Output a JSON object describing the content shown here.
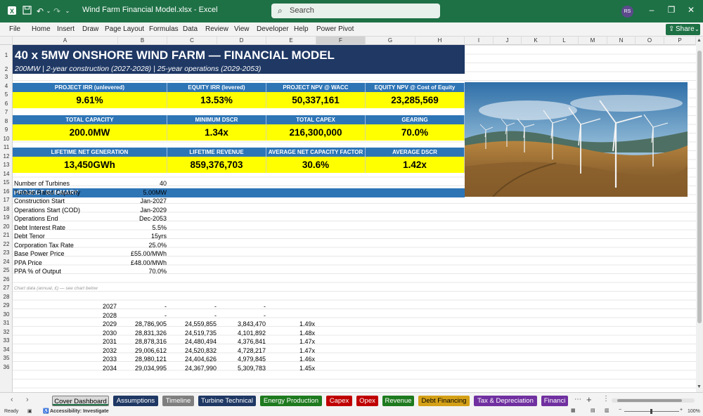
{
  "window": {
    "title": "Wind Farm Financial Model.xlsx  -  Excel",
    "search_placeholder": "Search",
    "user_initials": "RS"
  },
  "ribbon": {
    "tabs": [
      "File",
      "Home",
      "Insert",
      "Draw",
      "Page Layout",
      "Formulas",
      "Data",
      "Review",
      "View",
      "Developer",
      "Help",
      "Power Pivot"
    ],
    "share_label": "Share"
  },
  "columns": [
    "A",
    "B",
    "C",
    "D",
    "E",
    "F",
    "G",
    "H",
    "I",
    "J",
    "K",
    "L",
    "M",
    "N",
    "O",
    "P"
  ],
  "rows": [
    "1",
    "2",
    "3",
    "4",
    "5",
    "6",
    "7",
    "8",
    "9",
    "10",
    "11",
    "12",
    "13",
    "14",
    "15",
    "16",
    "17",
    "18",
    "19",
    "20",
    "21",
    "22",
    "23",
    "24",
    "25",
    "26",
    "27",
    "28",
    "29",
    "30",
    "31",
    "32",
    "33",
    "34",
    "35",
    "36"
  ],
  "sheet": {
    "title": "40 x 5MW ONSHORE WIND FARM — FINANCIAL MODEL",
    "subtitle": "200MW | 2-year construction (2027-2028) | 25-year operations (2029-2053)",
    "kpi_rows": [
      [
        {
          "label": "PROJECT IRR (unlevered)",
          "value": "9.61%"
        },
        {
          "label": "EQUITY IRR (levered)",
          "value": "13.53%"
        },
        {
          "label": "PROJECT NPV @ WACC",
          "value": "50,337,161"
        },
        {
          "label": "EQUITY NPV @ Cost of Equity",
          "value": "23,285,569"
        }
      ],
      [
        {
          "label": "TOTAL CAPACITY",
          "value": "200.0MW"
        },
        {
          "label": "MINIMUM DSCR",
          "value": "1.34x"
        },
        {
          "label": "TOTAL CAPEX",
          "value": "216,300,000"
        },
        {
          "label": "GEARING",
          "value": "70.0%"
        }
      ],
      [
        {
          "label": "LIFETIME NET GENERATION",
          "value": "13,450GWh"
        },
        {
          "label": "LIFETIME REVENUE",
          "value": "859,376,703"
        },
        {
          "label": "AVERAGE NET CAPACITY FACTOR",
          "value": "30.6%"
        },
        {
          "label": "AVERAGE DSCR",
          "value": "1.42x"
        }
      ]
    ],
    "summary_heading": "PROJECT SUMMARY",
    "summary": [
      {
        "label": "Number of Turbines",
        "value": "40"
      },
      {
        "label": "Turbine Rated Capacity",
        "value": "5.00MW"
      },
      {
        "label": "Construction Start",
        "value": "Jan-2027"
      },
      {
        "label": "Operations Start (COD)",
        "value": "Jan-2029"
      },
      {
        "label": "Operations End",
        "value": "Dec-2053"
      },
      {
        "label": "Debt Interest Rate",
        "value": "5.5%"
      },
      {
        "label": "Debt Tenor",
        "value": "15yrs"
      },
      {
        "label": "Corporation Tax Rate",
        "value": "25.0%"
      },
      {
        "label": "Base Power Price",
        "value": "£55.00/MWh"
      },
      {
        "label": "PPA Price",
        "value": "£48.00/MWh"
      },
      {
        "label": "PPA % of Output",
        "value": "70.0%"
      }
    ],
    "chart_note": "Chart data (annual, £) — see chart below",
    "chart_rows": [
      [
        "2027",
        "-",
        "-",
        "-",
        ""
      ],
      [
        "2028",
        "-",
        "-",
        "-",
        ""
      ],
      [
        "2029",
        "28,786,905",
        "24,559,855",
        "3,843,470",
        "1.49x"
      ],
      [
        "2030",
        "28,831,326",
        "24,519,735",
        "4,101,892",
        "1.48x"
      ],
      [
        "2031",
        "28,878,316",
        "24,480,494",
        "4,376,841",
        "1.47x"
      ],
      [
        "2032",
        "29,006,612",
        "24,520,832",
        "4,728,217",
        "1.47x"
      ],
      [
        "2033",
        "28,980,121",
        "24,404,626",
        "4,979,845",
        "1.46x"
      ],
      [
        "2034",
        "29,034,995",
        "24,367,990",
        "5,309,783",
        "1.45x"
      ]
    ]
  },
  "sheet_tabs": [
    {
      "label": "Cover Dashboard",
      "color": "#d9d9d9",
      "text": "#000000"
    },
    {
      "label": "Assumptions",
      "color": "#1f3864",
      "text": "#ffffff"
    },
    {
      "label": "Timeline",
      "color": "#7f7f7f",
      "text": "#ffffff"
    },
    {
      "label": "Turbine Technical",
      "color": "#1f3864",
      "text": "#ffffff"
    },
    {
      "label": "Energy Production",
      "color": "#1e7a1e",
      "text": "#ffffff"
    },
    {
      "label": "Capex",
      "color": "#c00000",
      "text": "#ffffff"
    },
    {
      "label": "Opex",
      "color": "#c00000",
      "text": "#ffffff"
    },
    {
      "label": "Revenue",
      "color": "#1e7a1e",
      "text": "#ffffff"
    },
    {
      "label": "Debt Financing",
      "color": "#d4a017",
      "text": "#000000"
    },
    {
      "label": "Tax & Depreciation",
      "color": "#7030a0",
      "text": "#ffffff"
    },
    {
      "label": "Financi",
      "color": "#7030a0",
      "text": "#ffffff"
    }
  ],
  "status": {
    "ready": "Ready",
    "accessibility": "Accessibility: Investigate",
    "zoom": "100%"
  }
}
